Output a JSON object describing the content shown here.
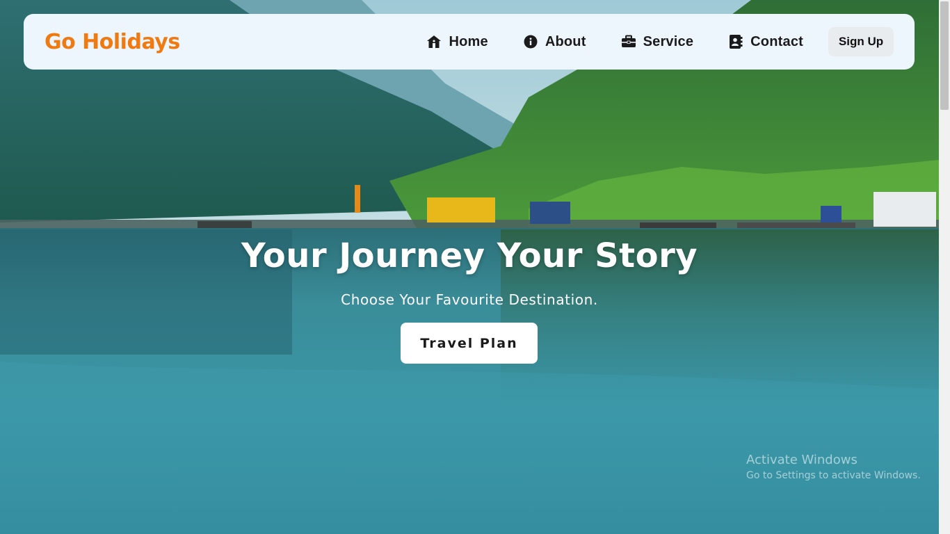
{
  "brand": {
    "name": "Go Holidays",
    "color": "#f07a12"
  },
  "nav": {
    "items": [
      {
        "label": "Home",
        "icon": "home-icon"
      },
      {
        "label": "About",
        "icon": "info-icon"
      },
      {
        "label": "Service",
        "icon": "briefcase-icon"
      },
      {
        "label": "Contact",
        "icon": "address-book-icon"
      }
    ],
    "signup_label": "Sign Up"
  },
  "hero": {
    "title": "Your Journey Your Story",
    "subtitle": "Choose Your Favourite Destination.",
    "cta_label": "Travel Plan"
  },
  "watermark": {
    "title": "Activate Windows",
    "subtitle": "Go to Settings to activate Windows."
  }
}
